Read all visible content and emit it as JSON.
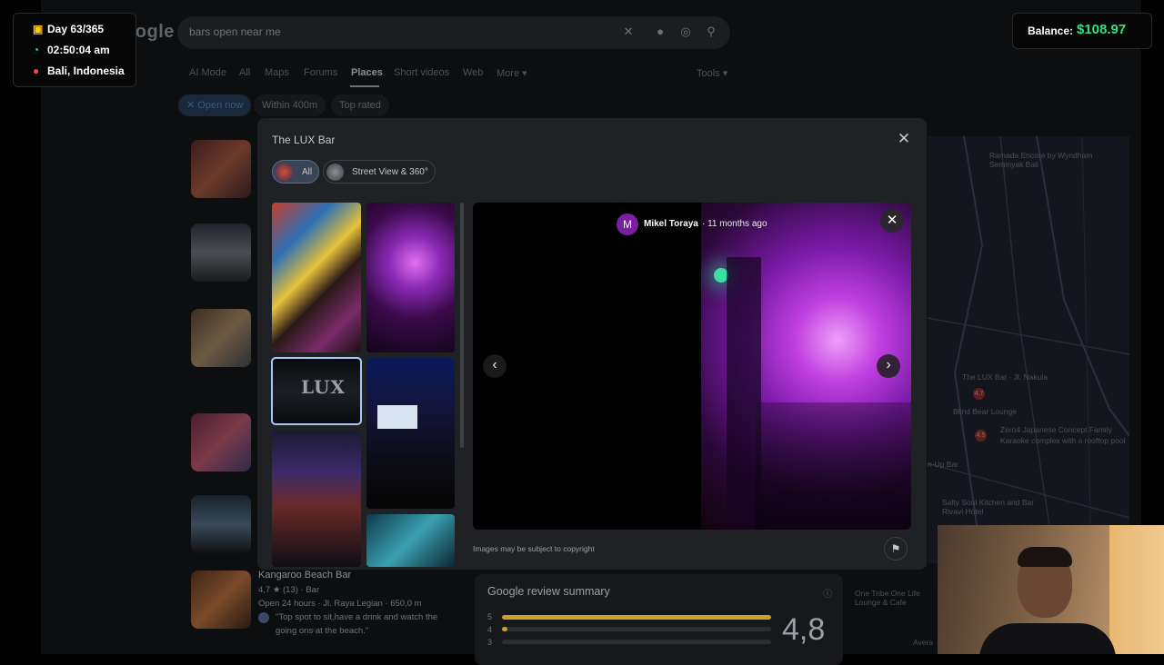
{
  "hud": {
    "day": "Day 63/365",
    "time": "02:50:04 am",
    "location": "Bali, Indonesia",
    "balance_label": "Balance:",
    "balance_value": "$108.97"
  },
  "search": {
    "logo_text": "Google",
    "query": "bars open near me",
    "tabs": [
      "AI Mode",
      "All",
      "Maps",
      "Forums",
      "Places",
      "Short videos",
      "Web",
      "More ▾"
    ],
    "active_tab": "Places",
    "tools": "Tools ▾",
    "filters": [
      "✕ Open now",
      "Within 400m",
      "Top rated"
    ]
  },
  "modal": {
    "title": "The LUX Bar",
    "chips": [
      "All",
      "Street View & 360°"
    ],
    "thumbnails": [
      {
        "name": "mural-crowd"
      },
      {
        "name": "purple-lights"
      },
      {
        "name": "lux-sign",
        "text": "LUX"
      },
      {
        "name": "projector-screen"
      },
      {
        "name": "blurry-stage"
      },
      {
        "name": "dark-room"
      },
      {
        "name": "colorful-lights"
      },
      {
        "name": "crowd-teal"
      }
    ],
    "viewer": {
      "author_initial": "M",
      "author": "Mikel Toraya",
      "posted": "· 11 months ago",
      "copyright": "Images may be subject to copyright"
    }
  },
  "background": {
    "result_name": "Kangaroo Beach Bar",
    "result_rating": "4,7 ★ (13) · Bar",
    "result_hours": "Open 24 hours · Jl. Raya Legian · 650,0 m",
    "result_quote_1": "\"Top spot to sit,have a drink and watch the",
    "result_quote_2": "going ons at the beach.\"",
    "review_title": "Google review summary",
    "review_score": "4,8",
    "review_rows": [
      "5",
      "4",
      "3"
    ],
    "map_labels": [
      "Ramada Encore by Wyndham Seminyak Bali",
      "The LUX Bar · Jl. Nakula",
      "Blind Bear Lounge",
      "Zero4 Japanese Concept Family",
      "Karaoke complex with a rooftop pool",
      "Salty Soul Kitchen and Bar Rivavi Hotel",
      "One Tribe One Life Lounge & Cafe",
      "n-Up Bar",
      "Avera"
    ],
    "map_pins": [
      "4.7",
      "4.5"
    ]
  },
  "colors": {
    "accent_blue": "#a8c7fa",
    "balance_green": "#36e07a",
    "author_purple": "#7b1fa2"
  }
}
